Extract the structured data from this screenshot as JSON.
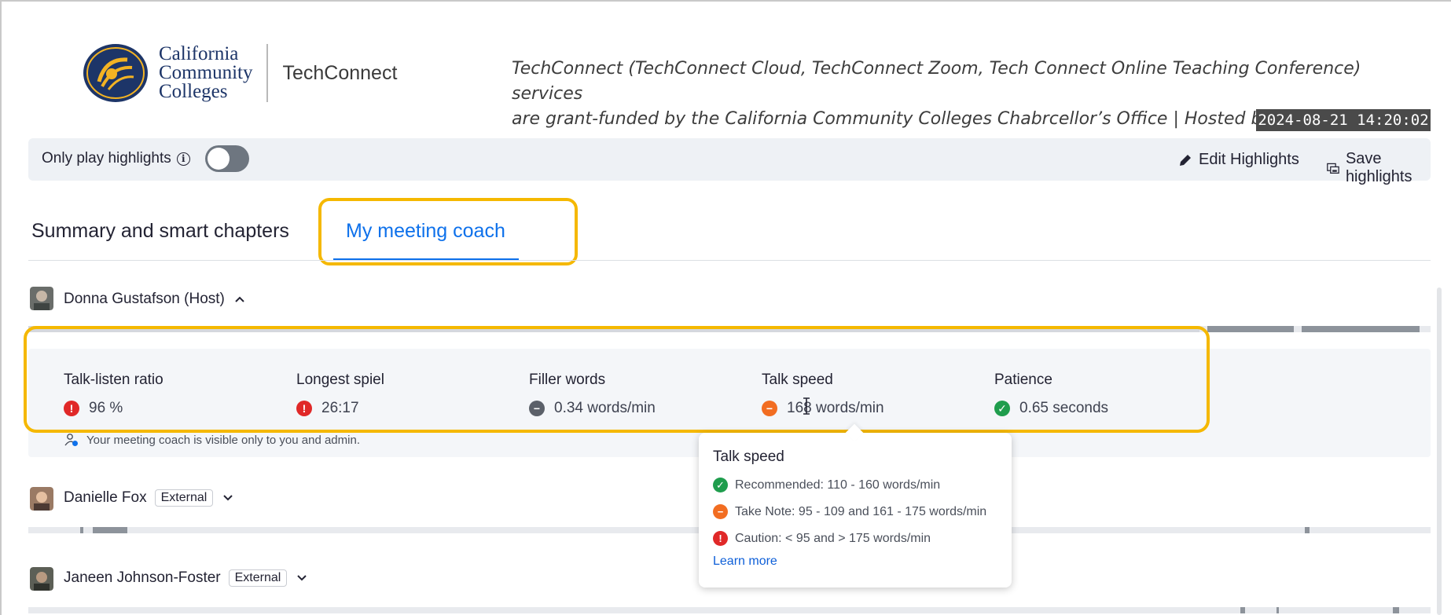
{
  "header": {
    "org_line1": "California",
    "org_line2": "Community",
    "org_line3": "Colleges",
    "product": "TechConnect",
    "notice_line1": "TechConnect (TechConnect Cloud, TechConnect Zoom, Tech Connect Online Teaching Conference) services",
    "notice_line2": "are grant-funded by the California Community Colleges Chabrcellor’s Office | Hosted bl Palomar College",
    "timestamp": "2024-08-21 14:20:02"
  },
  "highlights_bar": {
    "label": "Only play highlights",
    "toggle_on": false,
    "edit_label": "Edit Highlights",
    "save_label": "Save highlights"
  },
  "tabs": [
    {
      "label": "Summary and smart chapters",
      "active": false
    },
    {
      "label": "My meeting coach",
      "active": true
    }
  ],
  "participants": [
    {
      "name": "Donna Gustafson (Host)",
      "badge": "",
      "expanded": true
    },
    {
      "name": "Danielle Fox",
      "badge": "External",
      "expanded": false
    },
    {
      "name": "Janeen Johnson-Foster",
      "badge": "External",
      "expanded": false
    }
  ],
  "coach": {
    "metrics": [
      {
        "label": "Talk-listen ratio",
        "value": "96 %",
        "status": "caution"
      },
      {
        "label": "Longest spiel",
        "value": "26:17",
        "status": "caution"
      },
      {
        "label": "Filler words",
        "value": "0.34 words/min",
        "status": "neutral"
      },
      {
        "label": "Talk speed",
        "value": "168 words/min",
        "status": "take-note"
      },
      {
        "label": "Patience",
        "value": "0.65 seconds",
        "status": "recommended"
      }
    ],
    "note": "Your meeting coach is visible only to you and admin."
  },
  "tooltip": {
    "title": "Talk speed",
    "rows": [
      {
        "text": "Recommended: 110 - 160 words/min",
        "status": "recommended"
      },
      {
        "text": "Take Note: 95 - 109 and 161 - 175 words/min",
        "status": "take-note"
      },
      {
        "text": "Caution: < 95 and > 175 words/min",
        "status": "caution"
      }
    ],
    "link": "Learn more"
  },
  "colors": {
    "accent": "#0e71eb",
    "highlight_outline": "#f5b800",
    "caution": "#e02828",
    "take_note": "#f26d21",
    "recommended": "#1f9d4d"
  },
  "icons": {
    "info": "info-icon",
    "edit": "pencil-icon",
    "save": "save-icon",
    "chevron_up": "chevron-up-icon",
    "chevron_down": "chevron-down-icon",
    "privacy": "user-privacy-icon"
  }
}
